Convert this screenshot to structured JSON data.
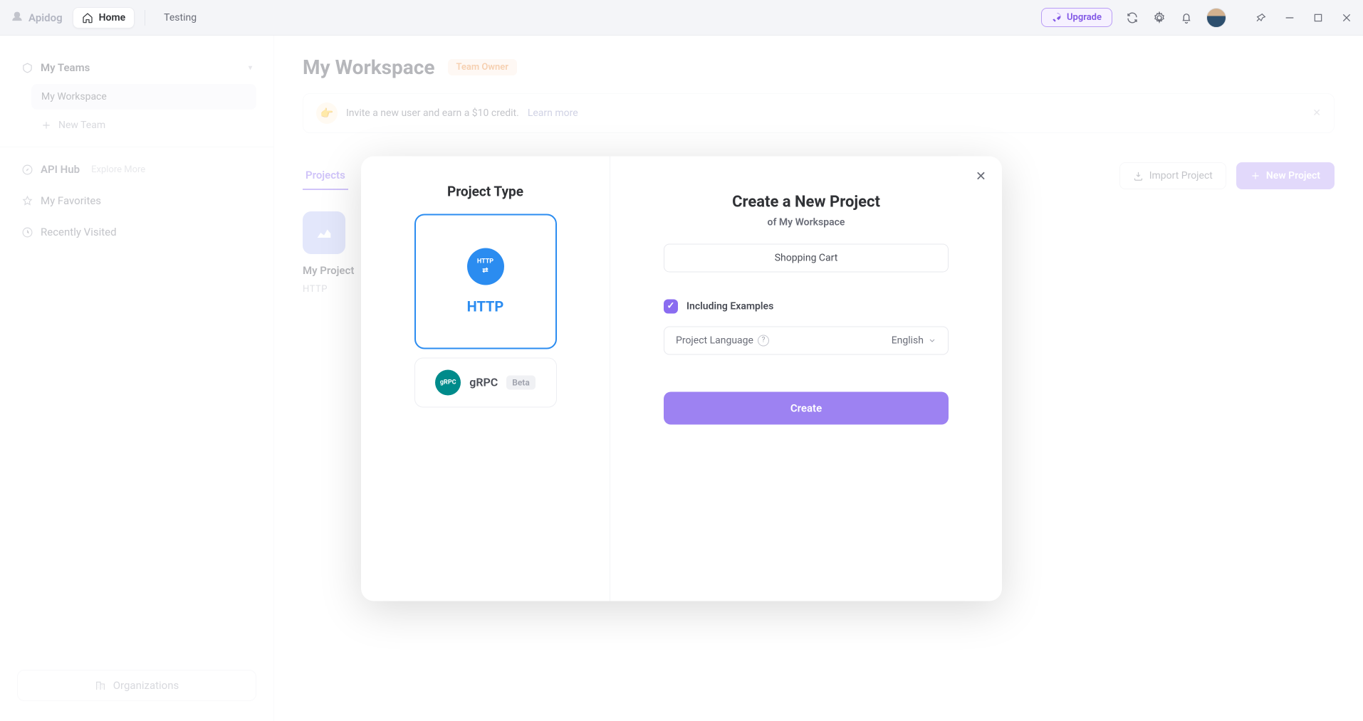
{
  "topbar": {
    "app_name": "Apidog",
    "tab_home": "Home",
    "tab_testing": "Testing",
    "upgrade": "Upgrade"
  },
  "sidebar": {
    "my_teams": "My Teams",
    "workspace": "My Workspace",
    "new_team": "New Team",
    "api_hub": "API Hub",
    "explore_more": "Explore More",
    "my_favorites": "My Favorites",
    "recently_visited": "Recently Visited",
    "organizations": "Organizations"
  },
  "main": {
    "title": "My Workspace",
    "badge": "Team Owner",
    "invite_text": "Invite a new user and earn a $10 credit.",
    "learn_more": "Learn more",
    "tab_projects": "Projects",
    "import_project": "Import Project",
    "new_project": "New Project",
    "card_name": "My Project",
    "card_type": "HTTP"
  },
  "modal": {
    "left_heading": "Project Type",
    "type_http": "HTTP",
    "http_icon_label": "HTTP",
    "type_grpc": "gRPC",
    "grpc_icon_label": "gRPC",
    "beta": "Beta",
    "right_heading": "Create a New Project",
    "subtitle": "of My Workspace",
    "name_value": "Shopping Cart",
    "include_examples": "Including Examples",
    "lang_label": "Project Language",
    "lang_value": "English",
    "create": "Create"
  }
}
